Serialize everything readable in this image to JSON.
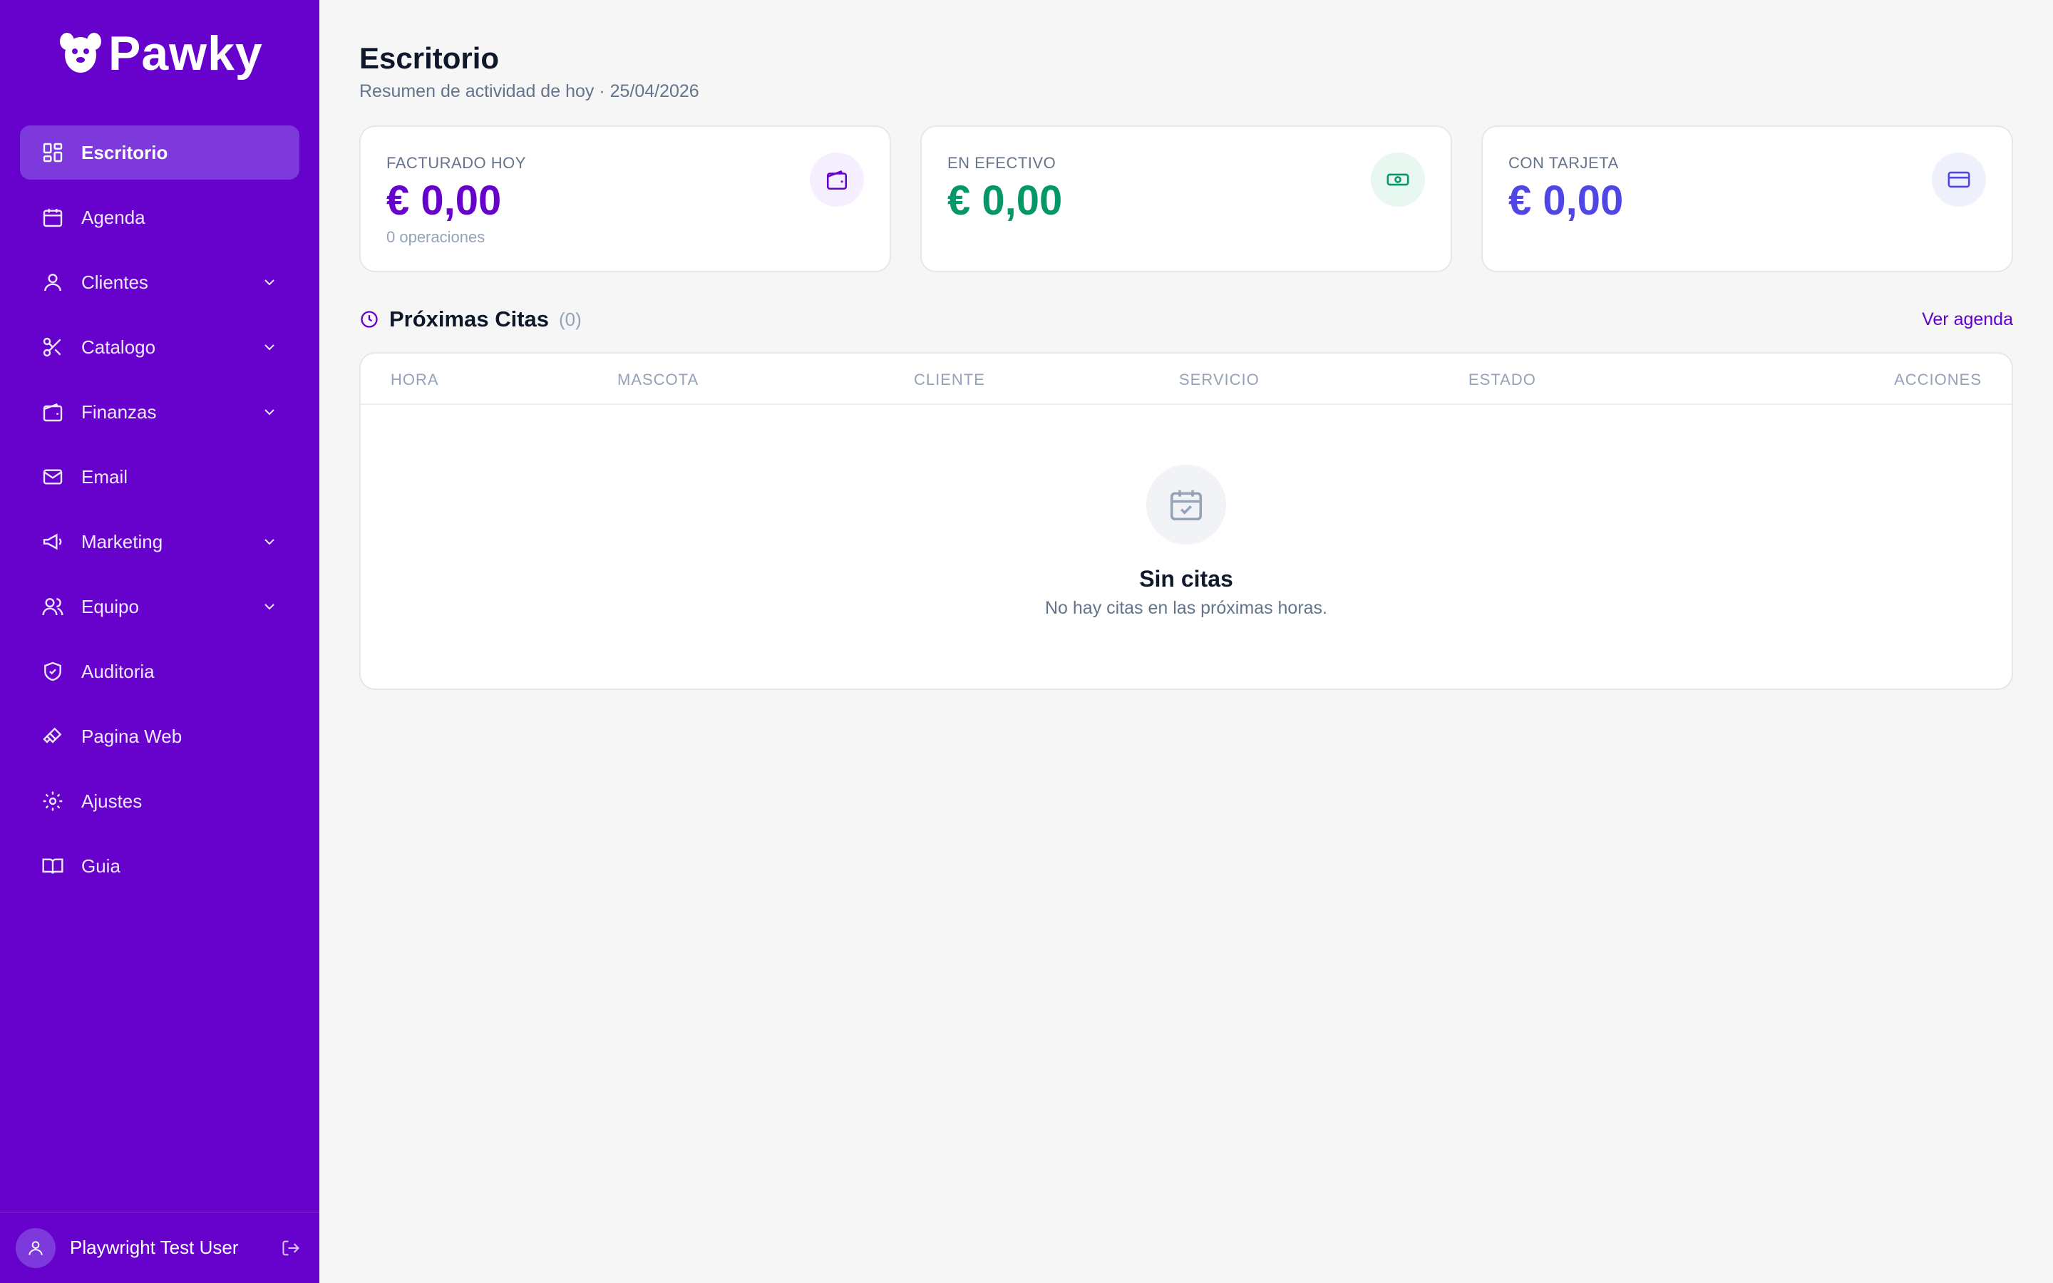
{
  "brand": {
    "name": "Pawky",
    "primary": "#6602cc",
    "active_bg": "#7e39dc"
  },
  "sidebar": {
    "items": [
      {
        "label": "Escritorio",
        "icon": "dashboard-grid-icon",
        "active": true,
        "expandable": false
      },
      {
        "label": "Agenda",
        "icon": "calendar-icon",
        "active": false,
        "expandable": false
      },
      {
        "label": "Clientes",
        "icon": "user-icon",
        "active": false,
        "expandable": true
      },
      {
        "label": "Catalogo",
        "icon": "scissors-icon",
        "active": false,
        "expandable": true
      },
      {
        "label": "Finanzas",
        "icon": "wallet-icon",
        "active": false,
        "expandable": true
      },
      {
        "label": "Email",
        "icon": "mail-icon",
        "active": false,
        "expandable": false
      },
      {
        "label": "Marketing",
        "icon": "megaphone-icon",
        "active": false,
        "expandable": true
      },
      {
        "label": "Equipo",
        "icon": "users-icon",
        "active": false,
        "expandable": true
      },
      {
        "label": "Auditoria",
        "icon": "shield-check-icon",
        "active": false,
        "expandable": false
      },
      {
        "label": "Pagina Web",
        "icon": "brush-icon",
        "active": false,
        "expandable": false
      },
      {
        "label": "Ajustes",
        "icon": "gear-icon",
        "active": false,
        "expandable": false
      },
      {
        "label": "Guia",
        "icon": "book-icon",
        "active": false,
        "expandable": false
      }
    ],
    "user": {
      "name": "Playwright Test User"
    }
  },
  "header": {
    "title": "Escritorio",
    "subtitle": "Resumen de actividad de hoy · 25/04/2026"
  },
  "stats": [
    {
      "label": "FACTURADO HOY",
      "value": "€ 0,00",
      "meta": "0 operaciones",
      "color": "#6602cc",
      "icon_bg": "#f6efff",
      "icon": "wallet-icon"
    },
    {
      "label": "EN EFECTIVO",
      "value": "€ 0,00",
      "meta": "",
      "color": "#059669",
      "icon_bg": "#e8f8f1",
      "icon": "cash-icon"
    },
    {
      "label": "CON TARJETA",
      "value": "€ 0,00",
      "meta": "",
      "color": "#4f46e5",
      "icon_bg": "#eef0fb",
      "icon": "credit-card-icon"
    }
  ],
  "appointments": {
    "title": "Próximas Citas",
    "count": "(0)",
    "link": "Ver agenda",
    "columns": [
      "HORA",
      "MASCOTA",
      "CLIENTE",
      "SERVICIO",
      "ESTADO",
      "ACCIONES"
    ],
    "empty_title": "Sin citas",
    "empty_text": "No hay citas en las próximas horas."
  }
}
